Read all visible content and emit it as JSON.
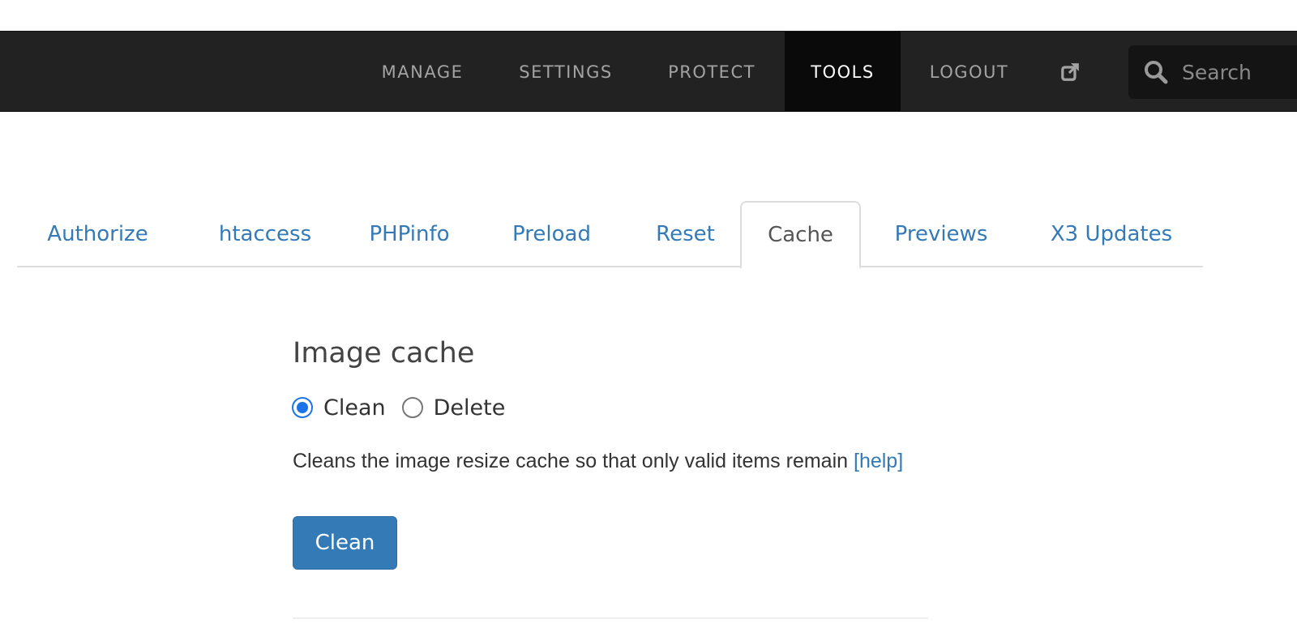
{
  "nav": {
    "items": [
      {
        "label": "MANAGE"
      },
      {
        "label": "SETTINGS"
      },
      {
        "label": "PROTECT"
      },
      {
        "label": "TOOLS"
      },
      {
        "label": "LOGOUT"
      }
    ],
    "active": "TOOLS",
    "external_icon": "external-link-icon"
  },
  "search": {
    "placeholder": "Search",
    "icon": "search-icon"
  },
  "tabs": {
    "items": [
      {
        "label": "Authorize"
      },
      {
        "label": "htaccess"
      },
      {
        "label": "PHPinfo"
      },
      {
        "label": "Preload"
      },
      {
        "label": "Reset"
      },
      {
        "label": "Cache"
      },
      {
        "label": "Previews"
      },
      {
        "label": "X3 Updates"
      }
    ],
    "active": "Cache"
  },
  "image_cache": {
    "title": "Image cache",
    "options": [
      {
        "label": "Clean",
        "checked": true
      },
      {
        "label": "Delete",
        "checked": false
      }
    ],
    "description": "Cleans the image resize cache so that only valid items remain",
    "help_label": "[help]",
    "button_label": "Clean"
  },
  "colors": {
    "navbar_bg": "#222222",
    "nav_active_bg": "#0a0a0a",
    "link": "#337ab7",
    "button_bg": "#337ab7",
    "radio_checked": "#1a73e8"
  }
}
